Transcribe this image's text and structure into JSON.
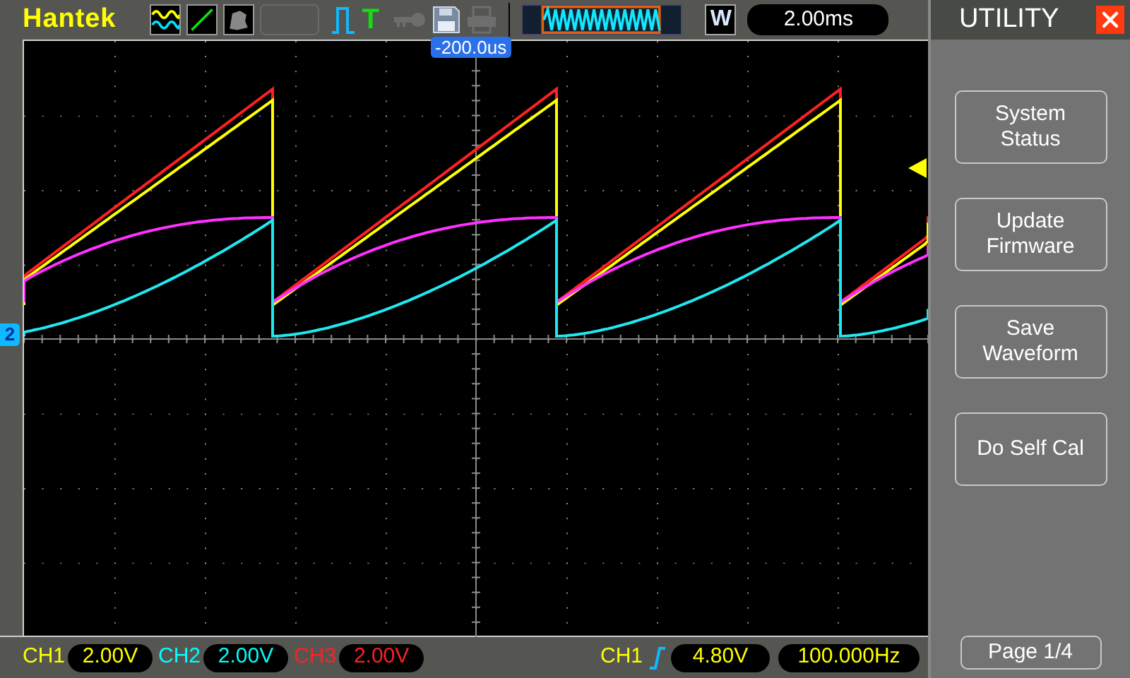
{
  "top_bar": {
    "logo": "Hantek",
    "trigger_icon": "T",
    "window_label": "W",
    "timebase": "2.00ms"
  },
  "plot": {
    "time_offset": "-200.0us",
    "channel_marker": "2"
  },
  "menu": {
    "title": "UTILITY",
    "buttons": [
      "System Status",
      "Update Firmware",
      "Save Waveform",
      "Do Self Cal"
    ],
    "page": "Page 1/4"
  },
  "channels": [
    {
      "label": "CH1",
      "scale": "2.00V",
      "color": "#ffff00"
    },
    {
      "label": "CH2",
      "scale": "2.00V",
      "color": "#00ffff"
    },
    {
      "label": "CH3",
      "scale": "2.00V",
      "color": "#ff2020"
    }
  ],
  "trigger": {
    "source": "CH1",
    "level": "4.80V",
    "frequency": "100.000Hz"
  }
}
